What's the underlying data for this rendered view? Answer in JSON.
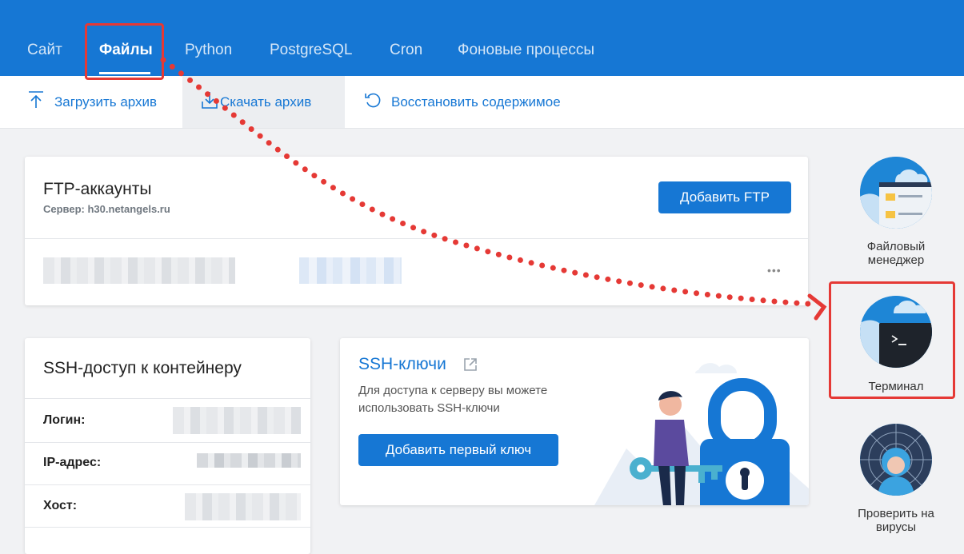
{
  "nav": {
    "tabs": [
      {
        "label": "Сайт"
      },
      {
        "label": "Файлы"
      },
      {
        "label": "Python"
      },
      {
        "label": "PostgreSQL"
      },
      {
        "label": "Cron"
      },
      {
        "label": "Фоновые процессы"
      }
    ],
    "active_tab": "Файлы"
  },
  "toolbar": {
    "upload_label": "Загрузить архив",
    "download_label": "Скачать архив",
    "restore_label": "Восстановить содержимое"
  },
  "ftp": {
    "title": "FTP-аккаунты",
    "server": "Сервер: h30.netangels.ru",
    "add_button": "Добавить FTP",
    "more": "•••"
  },
  "ssh": {
    "title": "SSH-доступ к контейнеру",
    "login_label": "Логин:",
    "ip_label": "IP-адрес:",
    "host_label": "Хост:"
  },
  "ssh_keys": {
    "title": "SSH-ключи",
    "description": "Для доступа к серверу вы можете использовать SSH-ключи",
    "add_button": "Добавить первый ключ"
  },
  "side": {
    "file_manager": "Файловый менеджер",
    "terminal": "Терминал",
    "virus_check": "Проверить на вирусы"
  },
  "colors": {
    "brand": "#1677d4",
    "annotation": "#e53935",
    "background": "#f1f2f4"
  },
  "icons": [
    "upload-icon",
    "download-icon",
    "restore-icon",
    "external-link-icon",
    "file-manager-icon",
    "terminal-icon",
    "virus-scan-icon"
  ]
}
